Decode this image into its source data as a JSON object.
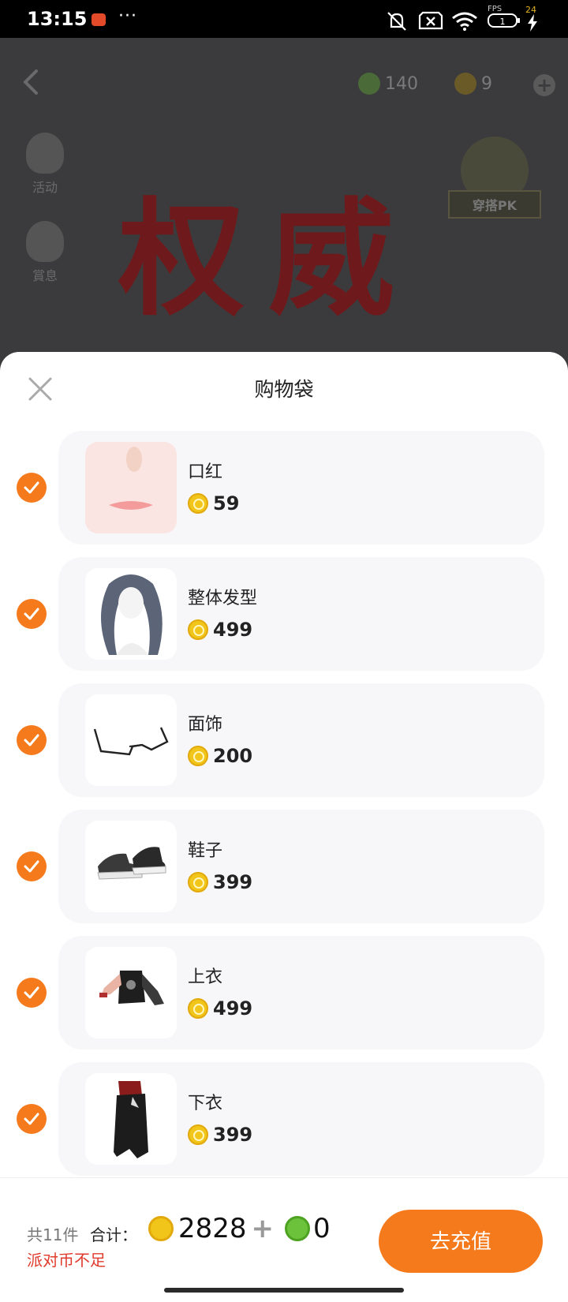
{
  "status_bar": {
    "time": "13:15",
    "more": "···",
    "fps_label": "FPS",
    "fps_value": "24",
    "icons": [
      "app-notification-icon",
      "mute-icon",
      "sim-off-icon",
      "wifi-icon",
      "battery-icon",
      "charging-icon"
    ]
  },
  "background": {
    "green_coin_amount": "140",
    "gold_coin_amount": "9",
    "side_items": [
      {
        "label": "活动"
      },
      {
        "label": "賞息"
      }
    ],
    "title": "权威",
    "pk_label": "穿搭PK"
  },
  "sheet": {
    "title": "购物袋",
    "items": [
      {
        "name": "口红",
        "price": "59",
        "checked": true
      },
      {
        "name": "整体发型",
        "price": "499",
        "checked": true
      },
      {
        "name": "面饰",
        "price": "200",
        "checked": true
      },
      {
        "name": "鞋子",
        "price": "399",
        "checked": true
      },
      {
        "name": "上衣",
        "price": "499",
        "checked": true
      },
      {
        "name": "下衣",
        "price": "399",
        "checked": true
      }
    ]
  },
  "footer": {
    "count": "共11件",
    "total_label": "合计：",
    "gold_total": "2828",
    "plus": "+",
    "green_total": "0",
    "warning": "派对币不足",
    "recharge_label": "去充值"
  },
  "colors": {
    "accent": "#f57a1c",
    "warning": "#e03a2c",
    "gold_coin": "#f2c51a",
    "green_coin": "#6cc23a"
  }
}
